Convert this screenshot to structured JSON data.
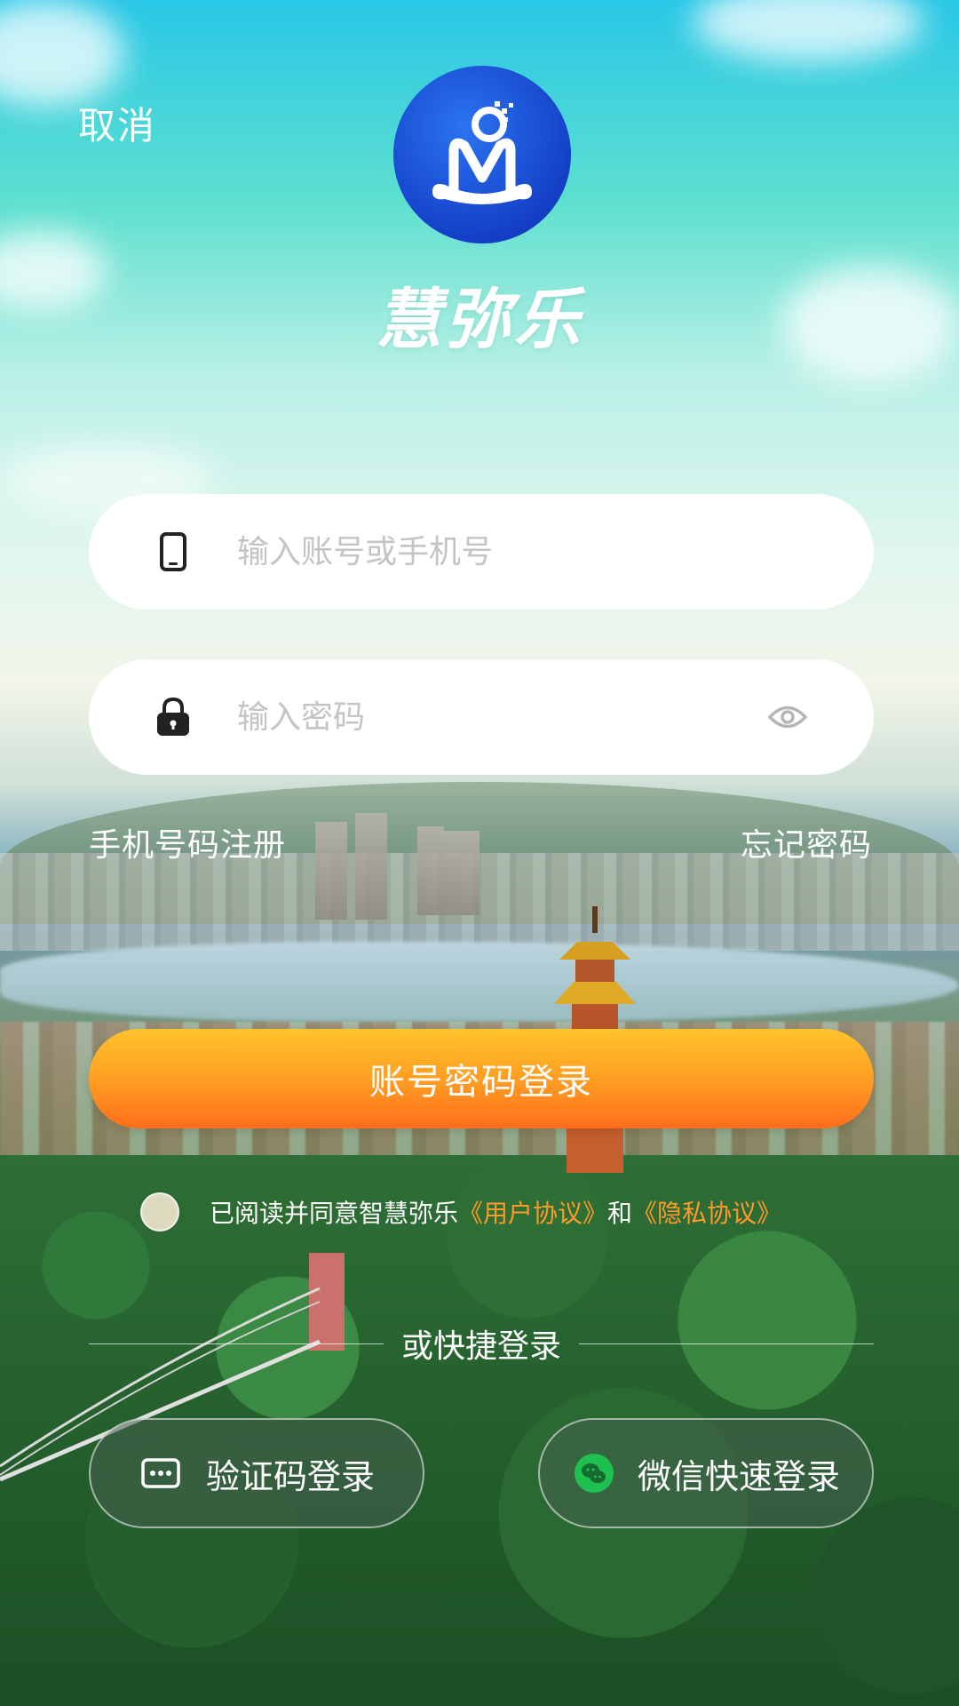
{
  "header": {
    "cancel_label": "取消"
  },
  "brand": {
    "app_name": "慧弥乐"
  },
  "login_form": {
    "account_placeholder": "输入账号或手机号",
    "password_placeholder": "输入密码",
    "account_icon": "phone-icon",
    "password_icon": "lock-icon",
    "show_password_icon": "eye-icon"
  },
  "links": {
    "register_label": "手机号码注册",
    "forgot_label": "忘记密码"
  },
  "primary_button": {
    "label": "账号密码登录"
  },
  "agreement": {
    "prefix": "已阅读并同意智慧弥乐",
    "user_agreement": "《用户协议》",
    "connector": "和",
    "privacy_agreement": "《隐私协议》"
  },
  "quick_login": {
    "divider_label": "或快捷登录",
    "sms_label": "验证码登录",
    "sms_icon": "sms-code-icon",
    "wechat_label": "微信快速登录",
    "wechat_icon": "wechat-icon"
  },
  "colors": {
    "accent_orange": "#ff8a1e",
    "link_orange": "#ff9a2a",
    "logo_blue": "#1a4fd8",
    "wechat_green": "#1ec04f"
  }
}
